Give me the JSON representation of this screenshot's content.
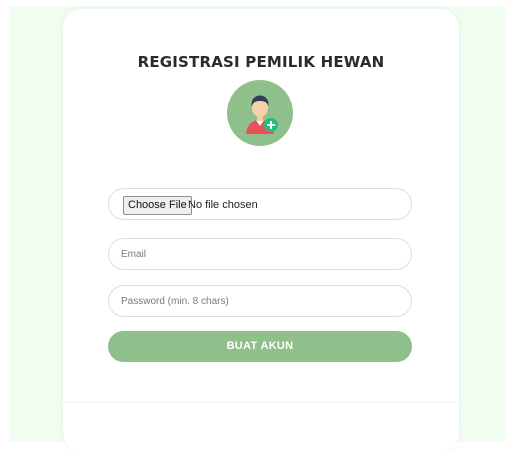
{
  "form": {
    "title": "REGISTRASI PEMILIK HEWAN",
    "avatar_icon": "add-user-icon",
    "file_button_label": "Choose File",
    "file_status": "No file chosen",
    "email_placeholder": "Email",
    "password_placeholder": "Password (min. 8 chars)",
    "submit_label": "BUAT AKUN"
  },
  "colors": {
    "accent": "#8fbf8a",
    "page_background": "#f0fdf0",
    "card_background": "#ffffff"
  }
}
